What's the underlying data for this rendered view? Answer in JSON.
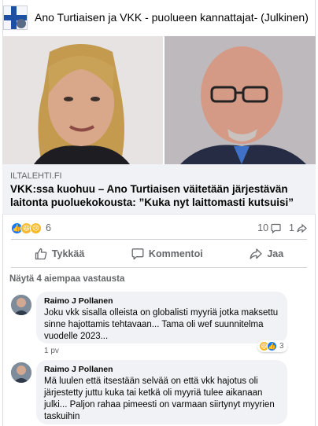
{
  "group": {
    "title": "Ano Turtiaisen ja VKK - puolueen kannattajat- (Julkinen)"
  },
  "post": {
    "link_source": "ILTALEHTI.FI",
    "headline": "VKK:ssa kuohuu – Ano Turtiaisen väitetään järjestävän laitonta puoluekokousta: ”Kuka nyt laittomasti kutsuisi”",
    "reaction_count": "6",
    "comment_count": "10",
    "share_count": "1"
  },
  "actions": {
    "like": "Tykkää",
    "comment": "Kommentoi",
    "share": "Jaa"
  },
  "previous_replies": "Näytä 4 aiempaa vastausta",
  "comments": [
    {
      "author": "Raimo J Pollanen",
      "text": "Joku vkk sisalla olleista on globalisti myyriä jotka maksettu sinne hajottamis tehtavaan... Tama oli wef suunnitelma vuodelle 2023...",
      "time": "1 pv",
      "reaction_count": "3"
    },
    {
      "author": "Raimo J Pollanen",
      "text": "Mä luulen että itsestään selvää on että vkk hajotus oli järjestetty juttu kuka tai ketkä oli myyriä tulee aikanaan julki... Paljon rahaa pimeesti on varmaan siirtynyt myyrien taskuihin"
    }
  ]
}
